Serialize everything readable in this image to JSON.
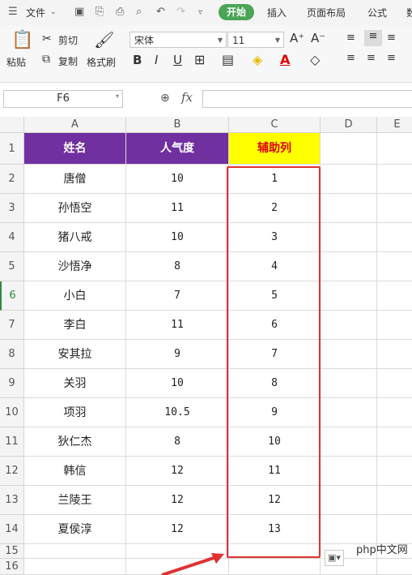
{
  "menu": {
    "file": "文件",
    "tabs": [
      "开始",
      "插入",
      "页面布局",
      "公式",
      "数"
    ]
  },
  "ribbon": {
    "paste": "粘贴",
    "cut": "剪切",
    "copy": "复制",
    "format_painter": "格式刷",
    "font_name": "宋体",
    "font_size": "11",
    "bold": "B",
    "italic": "I",
    "underline": "U"
  },
  "formula_bar": {
    "name_box": "F6",
    "fx": "fx",
    "value": ""
  },
  "sheet": {
    "columns": [
      "A",
      "B",
      "C",
      "D",
      "E"
    ],
    "rows": [
      "1",
      "2",
      "3",
      "4",
      "5",
      "6",
      "7",
      "8",
      "9",
      "10",
      "11",
      "12",
      "13",
      "14",
      "15",
      "16"
    ],
    "headers": [
      "姓名",
      "人气度",
      "辅助列"
    ],
    "data": [
      [
        "唐僧",
        "10",
        "1"
      ],
      [
        "孙悟空",
        "11",
        "2"
      ],
      [
        "猪八戒",
        "10",
        "3"
      ],
      [
        "沙悟净",
        "8",
        "4"
      ],
      [
        "小白",
        "7",
        "5"
      ],
      [
        "李白",
        "11",
        "6"
      ],
      [
        "安其拉",
        "9",
        "7"
      ],
      [
        "关羽",
        "10",
        "8"
      ],
      [
        "项羽",
        "10.5",
        "9"
      ],
      [
        "狄仁杰",
        "8",
        "10"
      ],
      [
        "韩信",
        "12",
        "11"
      ],
      [
        "兰陵王",
        "12",
        "12"
      ],
      [
        "夏侯淳",
        "12",
        "13"
      ]
    ]
  },
  "watermark": "php中文网",
  "colors": {
    "header_purple": "#7030a0",
    "header_yellow": "#ffff00",
    "highlight_red": "#e03030",
    "tab_green": "#4aa557"
  }
}
